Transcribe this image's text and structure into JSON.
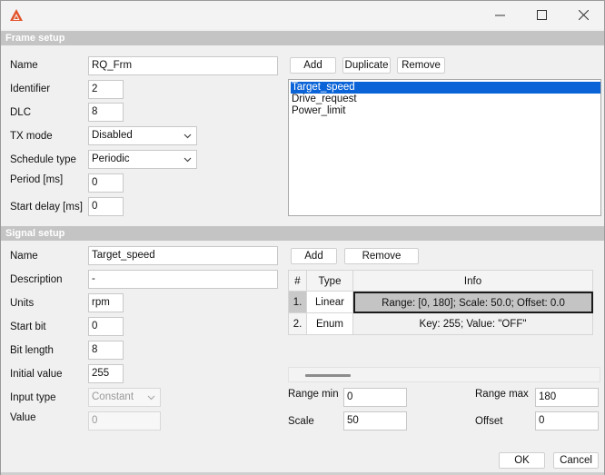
{
  "window": {
    "minimize_glyph": "—",
    "maximize_glyph": "☐",
    "close_glyph": "✕"
  },
  "frame_setup": {
    "title": "Frame setup",
    "name_label": "Name",
    "name_value": "RQ_Frm",
    "identifier_label": "Identifier",
    "identifier_value": "2",
    "dlc_label": "DLC",
    "dlc_value": "8",
    "tx_mode_label": "TX mode",
    "tx_mode_value": "Disabled",
    "schedule_label": "Schedule type",
    "schedule_value": "Periodic",
    "period_label": "Period [ms]",
    "period_value": "0",
    "start_delay_label": "Start delay [ms]",
    "start_delay_value": "0",
    "add_label": "Add",
    "duplicate_label": "Duplicate",
    "remove_label": "Remove",
    "signals": [
      "Target_speed",
      "Drive_request",
      "Power_limit"
    ]
  },
  "signal_setup": {
    "title": "Signal setup",
    "name_label": "Name",
    "name_value": "Target_speed",
    "description_label": "Description",
    "description_value": "-",
    "units_label": "Units",
    "units_value": "rpm",
    "start_bit_label": "Start bit",
    "start_bit_value": "0",
    "bit_length_label": "Bit length",
    "bit_length_value": "8",
    "initial_value_label": "Initial value",
    "initial_value_value": "255",
    "input_type_label": "Input type",
    "input_type_value": "Constant",
    "value_label": "Value",
    "value_value": "0",
    "add_label": "Add",
    "remove_label": "Remove",
    "table": {
      "headers": [
        "#",
        "Type",
        "Info"
      ],
      "rows": [
        {
          "num": "1.",
          "type": "Linear",
          "info": "Range: [0, 180]; Scale: 50.0; Offset: 0.0"
        },
        {
          "num": "2.",
          "type": "Enum",
          "info": "Key: 255; Value: \"OFF\""
        }
      ]
    },
    "range_min_label": "Range min",
    "range_min_value": "0",
    "range_max_label": "Range max",
    "range_max_value": "180",
    "scale_label": "Scale",
    "scale_value": "50",
    "offset_label": "Offset",
    "offset_value": "0"
  },
  "footer": {
    "ok_label": "OK",
    "cancel_label": "Cancel"
  },
  "colors": {
    "section_bar": "#c4c4c4",
    "selection": "#0a64d8",
    "app_icon": "#e2542a"
  },
  "icons": [
    "app-logo-icon",
    "minimize-icon",
    "maximize-icon",
    "close-icon",
    "chevron-down-icon"
  ]
}
